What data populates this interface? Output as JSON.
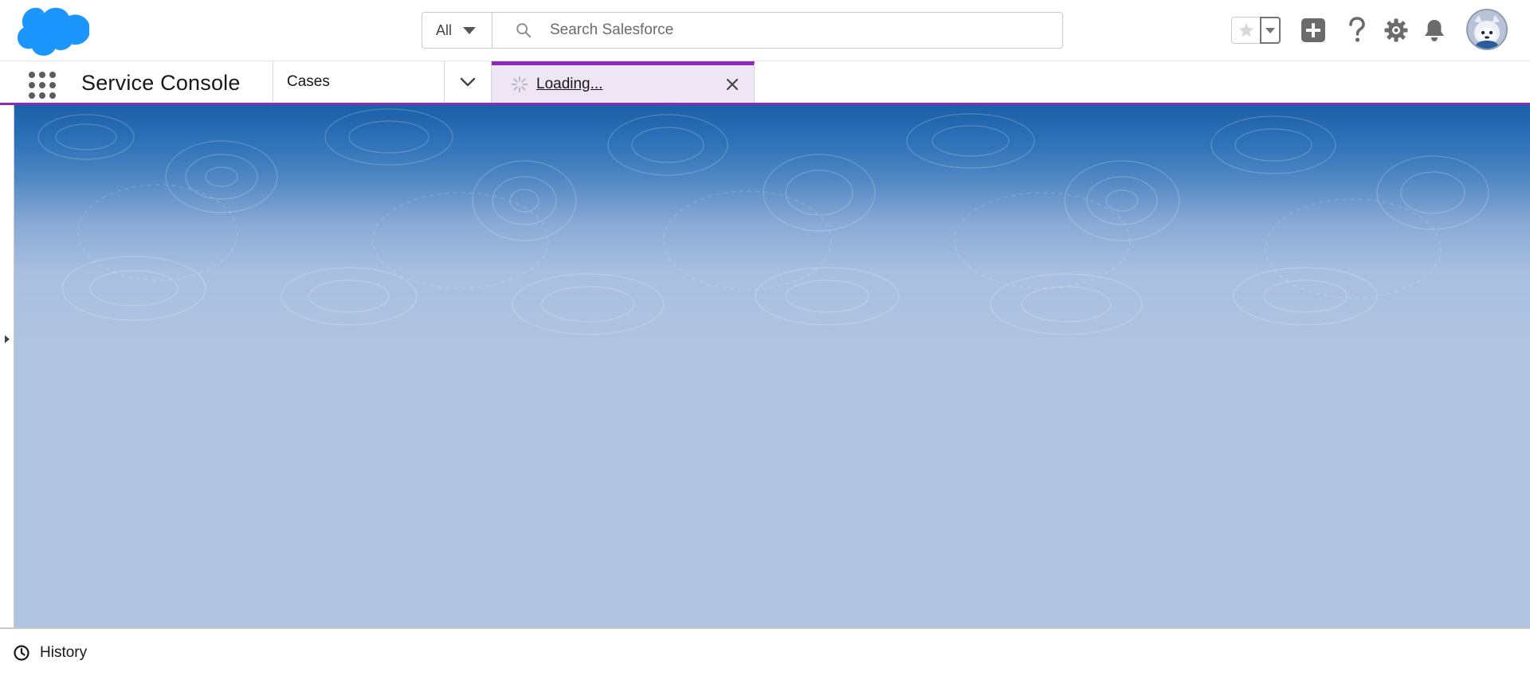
{
  "header": {
    "search_scope": "All",
    "search_placeholder": "Search Salesforce",
    "icons": [
      "salesforce-cloud-logo",
      "star-icon",
      "chevron-down-icon",
      "add-icon",
      "help-icon",
      "gear-icon",
      "bell-icon",
      "avatar"
    ]
  },
  "nav": {
    "app_name": "Service Console",
    "nav_item": "Cases",
    "workspace_tab": {
      "label": "Loading..."
    }
  },
  "utility_bar": {
    "history_label": "History"
  },
  "colors": {
    "brand_blue": "#1b96ff",
    "accent_purple": "#8a2bba",
    "tab_bg": "#efe6f5",
    "workspace_bg": "#b0c3df"
  }
}
